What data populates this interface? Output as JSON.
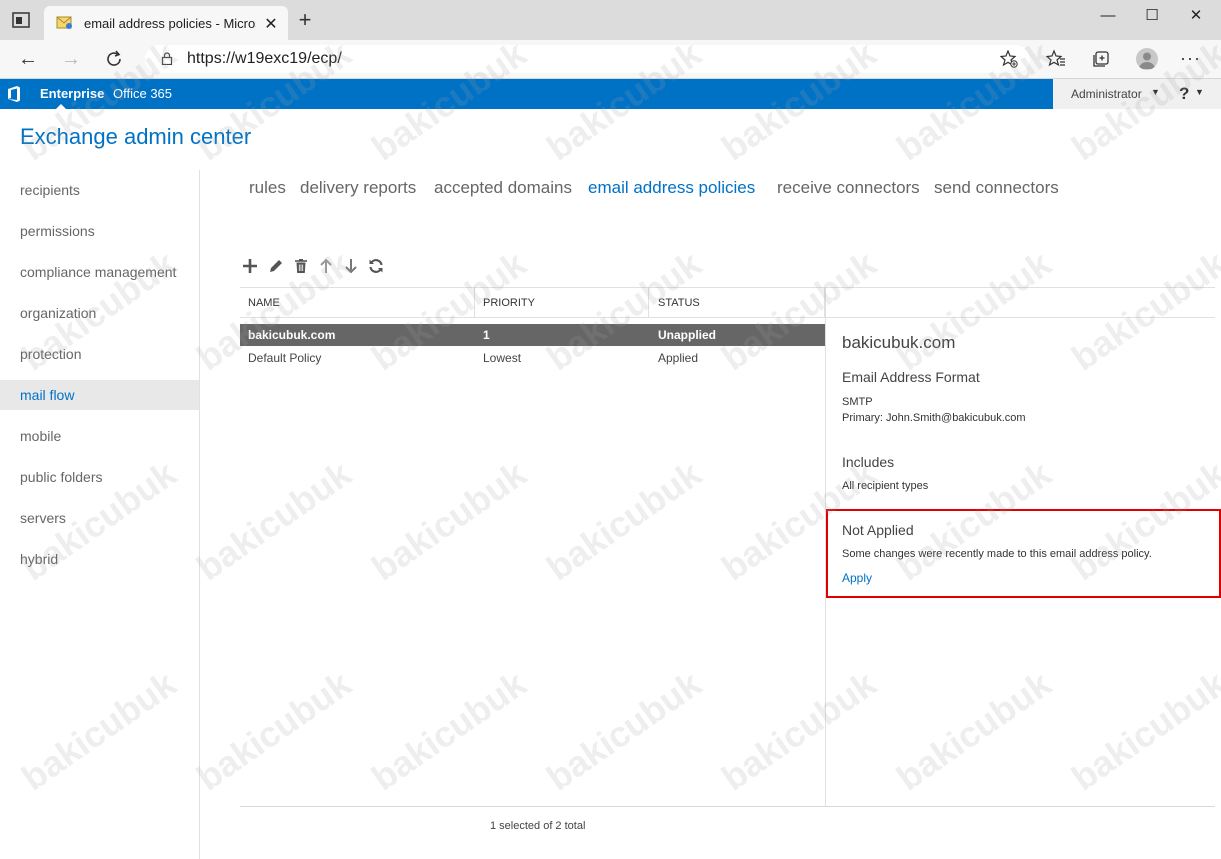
{
  "browser": {
    "tab_title": "email address policies - Microsoft",
    "tab_close": "✕",
    "new_tab": "+",
    "url": "https://w19exc19/ecp/",
    "win_minimize": "—",
    "win_maximize": "☐",
    "win_close": "✕",
    "back": "←",
    "forward": "→",
    "more": "···"
  },
  "o365bar": {
    "links": [
      "Enterprise",
      "Office 365"
    ],
    "user": "Administrator",
    "help": "?",
    "caret": "▼"
  },
  "app_title": "Exchange admin center",
  "leftnav": {
    "items": [
      "recipients",
      "permissions",
      "compliance management",
      "organization",
      "protection",
      "mail flow",
      "mobile",
      "public folders",
      "servers",
      "hybrid"
    ],
    "selected": "mail flow"
  },
  "subnav": {
    "items": [
      "rules",
      "delivery reports",
      "accepted domains",
      "email address policies",
      "receive connectors",
      "send connectors"
    ],
    "selected": "email address policies"
  },
  "toolbar": {
    "icons": [
      "add-icon",
      "edit-icon",
      "delete-icon",
      "move-up-icon",
      "move-down-icon",
      "refresh-icon"
    ]
  },
  "list": {
    "columns": [
      "NAME",
      "PRIORITY",
      "STATUS"
    ],
    "rows": [
      {
        "name": "bakicubuk.com",
        "priority": "1",
        "status": "Unapplied",
        "selected": true
      },
      {
        "name": "Default Policy",
        "priority": "Lowest",
        "status": "Applied",
        "selected": false
      }
    ],
    "footer": "1 selected of 2 total"
  },
  "details": {
    "title": "bakicubuk.com",
    "format_heading": "Email Address Format",
    "format_type": "SMTP",
    "format_primary": "Primary: John.Smith@bakicubuk.com",
    "includes_heading": "Includes",
    "includes_value": "All recipient types",
    "status_heading": "Not Applied",
    "status_text": "Some changes were recently made to this email address policy.",
    "apply_link": "Apply"
  },
  "watermark": "bakicubuk",
  "colors": {
    "brand_blue": "#0072c6",
    "selected_row": "#666666",
    "highlight": "#e00000"
  }
}
